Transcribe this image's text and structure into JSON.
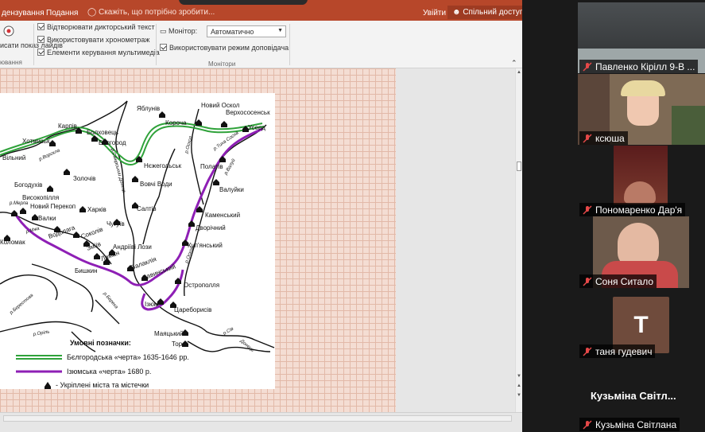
{
  "ribbon": {
    "tabs": [
      "дензування",
      "Подання"
    ],
    "tell_me": "Скажіть, що потрібно зробити...",
    "sign_in": "Увійти",
    "share": "Спільний доступ",
    "record_button": "исати показ\nлайдів",
    "record_group": "ювання",
    "checks": [
      "Відтворювати дикторський текст",
      "Використовувати хронометраж",
      "Елементи керування мультимедіа"
    ],
    "monitor_label": "Монітор:",
    "monitor_value": "Автоматично",
    "presenter_view": "Використовувати режим доповідача",
    "monitors_group": "Монітори"
  },
  "map": {
    "towns": [
      "Яблунів",
      "Новий Оскол",
      "Верхососенськ",
      "Усерд",
      "Корочa",
      "Карпів",
      "Болховець",
      "Хотмизьк",
      "Бєлгород",
      "Нєжегольськ",
      "Вільний",
      "Полатів",
      "Золочів",
      "Вовчі Води",
      "Валуйки",
      "Богодухів",
      "Салтів",
      "Харків",
      "Каменський",
      "Високопілля",
      "Новий Перекоп",
      "Валки",
      "Чугуїв",
      "Дворічний",
      "Водолага",
      "Соколів",
      "Коломак",
      "Зміїв",
      "Андріїві Лози",
      "Лиман",
      "Куп'янський",
      "Бишкин",
      "Балаклія",
      "Савинський",
      "Острополля",
      "Ізюм",
      "Цареборисів",
      "Маяцький",
      "Тор"
    ],
    "rivers": [
      "р.Ворскла",
      "р.Сіверськии Донець",
      "р.Оскол",
      "р.Тиха Сосна",
      "р.Валуй",
      "р.Мерла",
      "р.Мжа",
      "р.Берестова",
      "р.Берека",
      "р.Оріль",
      "р.Сів",
      "Донець",
      "р.Оскол"
    ],
    "legend_title": "Умовні позначки:",
    "legend": [
      {
        "label": "Бєлгородська «черта» 1635-1646 рр.",
        "color": "#2fa23a"
      },
      {
        "label": "Ізюмська «черта» 1680 р.",
        "color": "#8e1fb5"
      },
      {
        "label": "- Укріплені міста та містечки",
        "color": "#000000"
      }
    ]
  },
  "participants": [
    {
      "name": "Павленко Кірілл 9-В ...",
      "muted": true
    },
    {
      "name": "ксюша",
      "muted": true
    },
    {
      "name": "Пономаренко Дар'я",
      "muted": true
    },
    {
      "name": "Соня Ситало",
      "muted": true
    },
    {
      "name": "таня гудевич",
      "muted": true,
      "initial": "Т"
    },
    {
      "name": "Кузьміна Світлана",
      "muted": true,
      "big_label": "Кузьміна Світл..."
    }
  ]
}
